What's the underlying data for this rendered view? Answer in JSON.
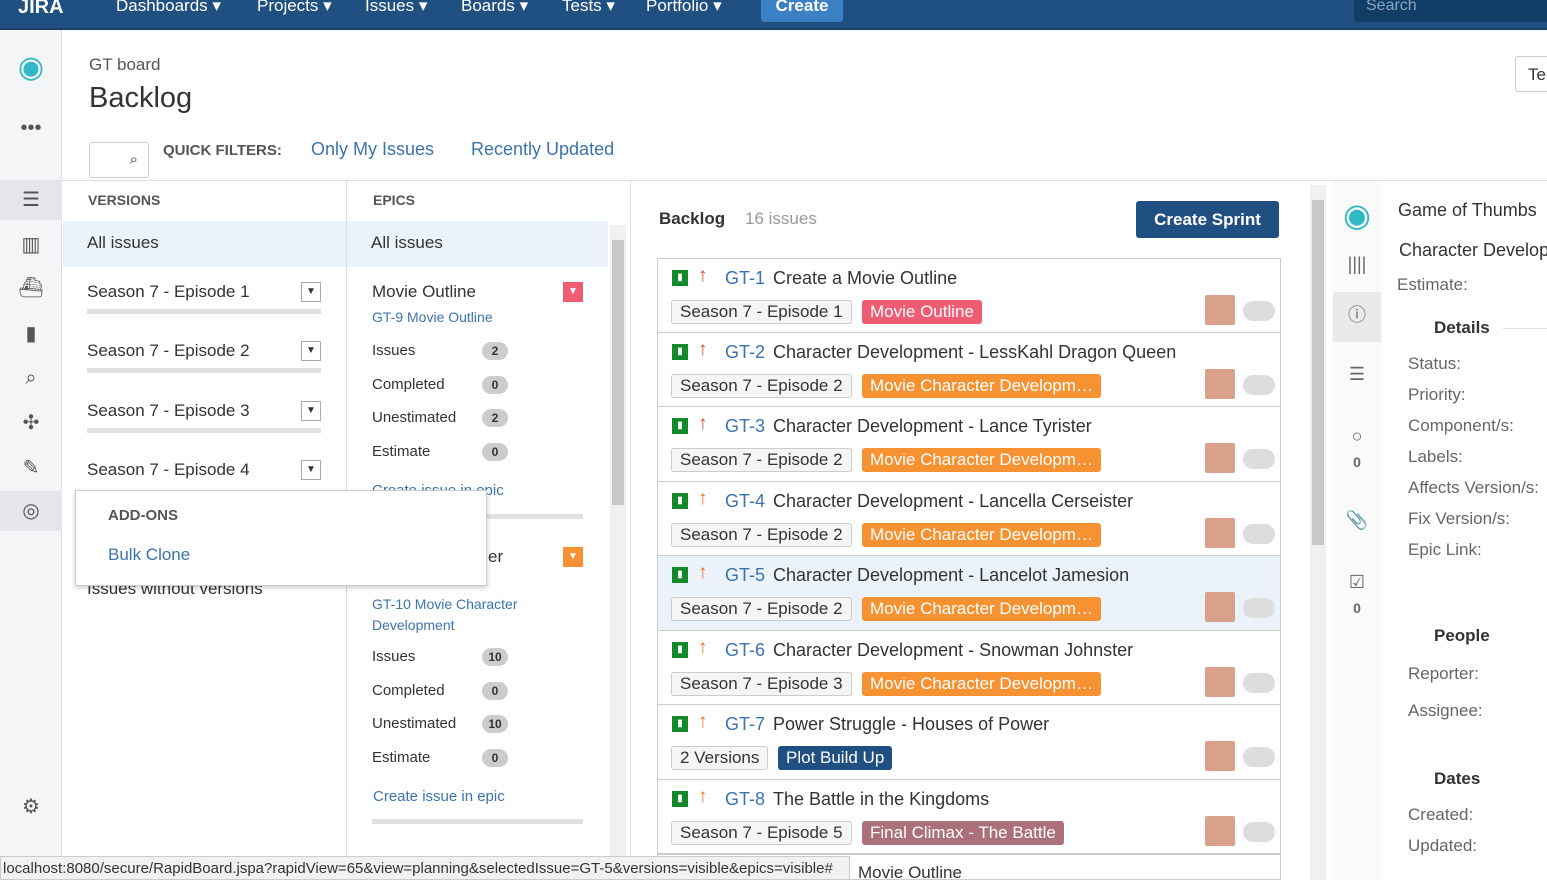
{
  "nav": {
    "logo": "JIRA",
    "items": [
      "Dashboards ▾",
      "Projects ▾",
      "Issues ▾",
      "Boards ▾",
      "Tests ▾",
      "Portfolio ▾"
    ],
    "create": "Create",
    "search": "Search"
  },
  "header": {
    "breadcrumb": "GT board",
    "title": "Backlog",
    "quick_filters_label": "QUICK FILTERS:",
    "filters": [
      "Only My Issues",
      "Recently Updated"
    ],
    "top_right": "Te"
  },
  "versions": {
    "heading": "VERSIONS",
    "all": "All issues",
    "items": [
      "Season 7 - Episode 1",
      "Season 7 - Episode 2",
      "Season 7 - Episode 3",
      "Season 7 - Episode 4"
    ],
    "without": "Issues without versions"
  },
  "addons": {
    "heading": "ADD-ONS",
    "item": "Bulk Clone"
  },
  "epics": {
    "heading": "EPICS",
    "all": "All issues",
    "create_link": "Create issue in epic",
    "e1": {
      "name": "Movie Outline",
      "key": "GT-9 Movie Outline",
      "stats": [
        [
          "Issues",
          "2"
        ],
        [
          "Completed",
          "0"
        ],
        [
          "Unestimated",
          "2"
        ],
        [
          "Estimate",
          "0"
        ]
      ],
      "color": "#f15c75"
    },
    "e2": {
      "name": "er",
      "key": "GT-10 Movie Character",
      "key2": "Development",
      "stats": [
        [
          "Issues",
          "10"
        ],
        [
          "Completed",
          "0"
        ],
        [
          "Unestimated",
          "10"
        ],
        [
          "Estimate",
          "0"
        ]
      ],
      "color": "#f79232"
    }
  },
  "backlog": {
    "title": "Backlog",
    "count": "16 issues",
    "create_sprint": "Create Sprint",
    "next_epic": "Movie Outline",
    "issues": [
      {
        "key": "GT-1",
        "summary": "Create a Movie Outline",
        "version": "Season 7 - Episode 1",
        "epic": "Movie Outline",
        "epic_color": "#f15c75",
        "priority": "high"
      },
      {
        "key": "GT-2",
        "summary": "Character Development - LessKahl Dragon Queen",
        "version": "Season 7 - Episode 2",
        "epic": "Movie Character Developm…",
        "epic_color": "#f79232",
        "priority": "high"
      },
      {
        "key": "GT-3",
        "summary": "Character Development - Lance Tyrister",
        "version": "Season 7 - Episode 2",
        "epic": "Movie Character Developm…",
        "epic_color": "#f79232",
        "priority": "high"
      },
      {
        "key": "GT-4",
        "summary": "Character Development - Lancella Cerseister",
        "version": "Season 7 - Episode 2",
        "epic": "Movie Character Developm…",
        "epic_color": "#f79232",
        "priority": "medium"
      },
      {
        "key": "GT-5",
        "summary": "Character Development - Lancelot Jamesion",
        "version": "Season 7 - Episode 2",
        "epic": "Movie Character Developm…",
        "epic_color": "#f79232",
        "priority": "medium",
        "selected": true
      },
      {
        "key": "GT-6",
        "summary": "Character Development - Snowman Johnster",
        "version": "Season 7 - Episode 3",
        "epic": "Movie Character Developm…",
        "epic_color": "#f79232",
        "priority": "medium"
      },
      {
        "key": "GT-7",
        "summary": "Power Struggle - Houses of Power",
        "version": "2 Versions",
        "epic": "Plot Build Up",
        "epic_color": "#205081",
        "priority": "medium"
      },
      {
        "key": "GT-8",
        "summary": "The Battle in the Kingdoms",
        "version": "Season 7 - Episode 5",
        "epic": "Final Climax - The Battle",
        "epic_color": "#ac707a",
        "priority": "medium"
      }
    ]
  },
  "detail": {
    "project": "Game of Thumbs",
    "summary": "Character Develop",
    "estimate": "Estimate:",
    "comments": "0",
    "checks": "0",
    "details_heading": "Details",
    "fields": [
      "Status:",
      "Priority:",
      "Component/s:",
      "Labels:",
      "Affects Version/s:",
      "Fix Version/s:",
      "Epic Link:"
    ],
    "people_heading": "People",
    "people": [
      "Reporter:",
      "Assignee:"
    ],
    "dates_heading": "Dates",
    "dates": [
      "Created:",
      "Updated:"
    ]
  },
  "statusbar": "localhost:8080/secure/RapidBoard.jspa?rapidView=65&view=planning&selectedIssue=GT-5&versions=visible&epics=visible#"
}
